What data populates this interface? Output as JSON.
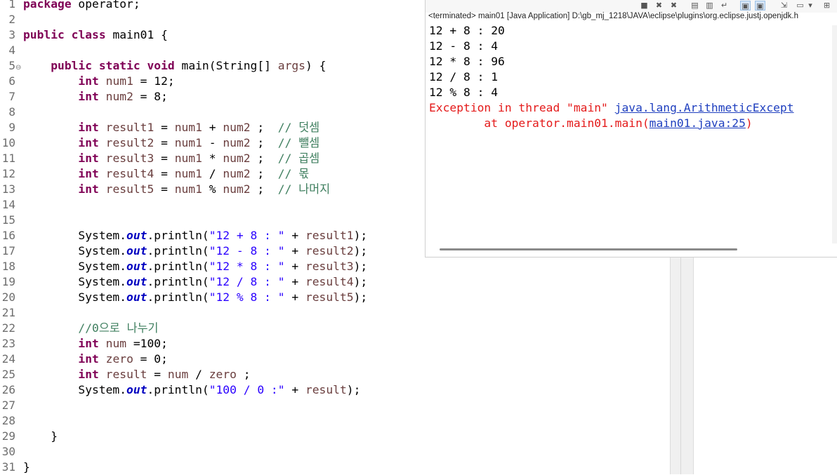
{
  "editor": {
    "lines": [
      {
        "num": "1",
        "code": "package operator;"
      },
      {
        "num": "2",
        "code": ""
      },
      {
        "num": "3",
        "code": "public class main01 {"
      },
      {
        "num": "4",
        "code": ""
      },
      {
        "num": "5",
        "code": "    public static void main(String[] args) {"
      },
      {
        "num": "6",
        "code": "        int num1 = 12;"
      },
      {
        "num": "7",
        "code": "        int num2 = 8;"
      },
      {
        "num": "8",
        "code": ""
      },
      {
        "num": "9",
        "code": "        int result1 = num1 + num2 ;  // 덧셈"
      },
      {
        "num": "10",
        "code": "        int result2 = num1 - num2 ;  // 뺄셈"
      },
      {
        "num": "11",
        "code": "        int result3 = num1 * num2 ;  // 곱셈"
      },
      {
        "num": "12",
        "code": "        int result4 = num1 / num2 ;  // 몫"
      },
      {
        "num": "13",
        "code": "        int result5 = num1 % num2 ;  // 나머지"
      },
      {
        "num": "14",
        "code": ""
      },
      {
        "num": "15",
        "code": ""
      },
      {
        "num": "16",
        "code": "        System.out.println(\"12 + 8 : \" + result1);"
      },
      {
        "num": "17",
        "code": "        System.out.println(\"12 - 8 : \" + result2);"
      },
      {
        "num": "18",
        "code": "        System.out.println(\"12 * 8 : \" + result3);"
      },
      {
        "num": "19",
        "code": "        System.out.println(\"12 / 8 : \" + result4);"
      },
      {
        "num": "20",
        "code": "        System.out.println(\"12 % 8 : \" + result5);"
      },
      {
        "num": "21",
        "code": ""
      },
      {
        "num": "22",
        "code": "        //0으로 나누기"
      },
      {
        "num": "23",
        "code": "        int num =100;"
      },
      {
        "num": "24",
        "code": "        int zero = 0;"
      },
      {
        "num": "25",
        "code": "        int result = num / zero ;"
      },
      {
        "num": "26",
        "code": "        System.out.println(\"100 / 0 :\" + result);"
      },
      {
        "num": "27",
        "code": ""
      },
      {
        "num": "28",
        "code": ""
      },
      {
        "num": "29",
        "code": "    }"
      },
      {
        "num": "30",
        "code": ""
      },
      {
        "num": "31",
        "code": "}"
      }
    ],
    "fold_marker": "⊖"
  },
  "console": {
    "status": "<terminated> main01 [Java Application] D:\\gb_mj_1218\\JAVA\\eclipse\\plugins\\org.eclipse.justj.openjdk.h",
    "output": [
      "12 + 8 : 20",
      "12 - 8 : 4",
      "12 * 8 : 96",
      "12 / 8 : 1",
      "12 % 8 : 4"
    ],
    "exception_prefix": "Exception in thread \"main\" ",
    "exception_class": "java.lang.ArithmeticExcept",
    "trace_prefix": "        at operator.main01.main(",
    "trace_link": "main01.java:25",
    "trace_suffix": ")",
    "toolbar_icons": [
      "stop-icon",
      "remove-launch-icon",
      "remove-all-icon",
      "clear-console-icon",
      "scroll-lock-icon",
      "word-wrap-icon",
      "show-stdout-icon",
      "show-stderr-icon",
      "pin-console-icon",
      "display-console-icon",
      "dropdown-icon",
      "open-console-icon"
    ]
  },
  "colors": {
    "keyword": "#7f0055",
    "string": "#2a00ff",
    "comment": "#3f7f5f",
    "field": "#0000c0",
    "error": "#e41a1a",
    "link": "#1f3fbf"
  }
}
